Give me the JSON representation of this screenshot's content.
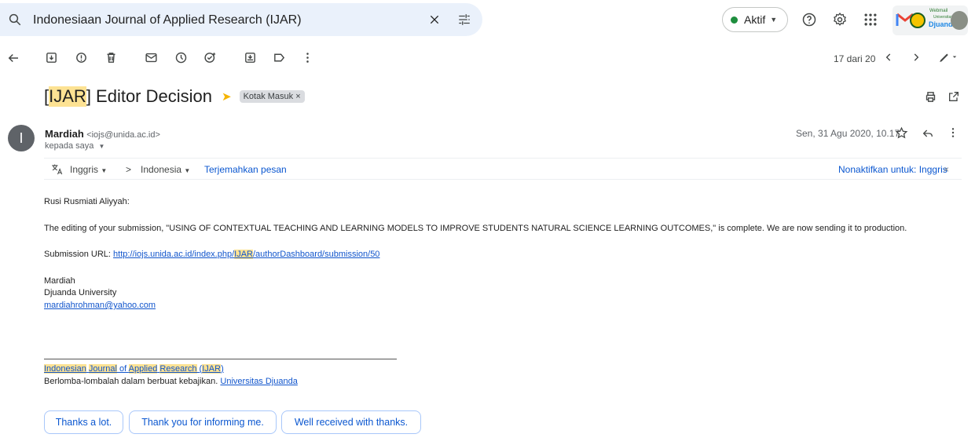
{
  "search": {
    "query": "Indonesiaan Journal of Applied Research (IJAR)"
  },
  "status": {
    "label": "Aktif",
    "color": "#1e8e3e"
  },
  "logo": {
    "line1": "Webmail",
    "line2": "Universitas",
    "line3": "Djuanda"
  },
  "toolbar": {
    "pager": "17 dari 20"
  },
  "email": {
    "subject_open": "[",
    "subject_hl": "IJAR",
    "subject_rest": "] Editor Decision",
    "label": "Kotak Masuk ×",
    "avatar_letter": "I",
    "sender_name": "Mardiah",
    "sender_email": "<iojs@unida.ac.id>",
    "recipient": "kepada saya",
    "date": "Sen, 31 Agu 2020, 10.17"
  },
  "translate": {
    "from": "Inggris",
    "to": "Indonesia",
    "translate_link": "Terjemahkan pesan",
    "disable": "Nonaktifkan untuk: Inggris"
  },
  "body": {
    "greeting": "Rusi Rusmiati Aliyyah:",
    "message": "The editing of your submission, \"USING OF CONTEXTUAL TEACHING AND LEARNING MODELS TO IMPROVE STUDENTS NATURAL SCIENCE LEARNING OUTCOMES,\" is complete. We are now sending it to production.",
    "url_label": "Submission URL: ",
    "url_a": "http://iojs.unida.ac.id/index.php/",
    "url_hl": "IJAR",
    "url_b": "/authorDashboard/submission/50",
    "sig_name": "Mardiah",
    "sig_org": "Djuanda University",
    "sig_email": "mardiahrohman@yahoo.com",
    "footer_w1": "Indonesian",
    "footer_w2": "Journal",
    "footer_of": " of ",
    "footer_w3": "Applied",
    "footer_w4": "Research",
    "footer_open": " (",
    "footer_w5": "IJAR",
    "footer_close": ")",
    "motto": "Berlomba-lombalah dalam berbuat kebajikan. ",
    "motto_link": "Universitas Djuanda"
  },
  "smart_replies": [
    "Thanks a lot.",
    "Thank you for informing me.",
    "Well received with thanks."
  ]
}
